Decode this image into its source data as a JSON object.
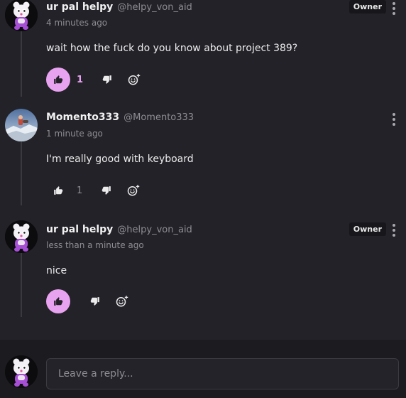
{
  "colors": {
    "background": "#232228",
    "reply_bar_background": "#1c1b20",
    "accent_pink": "#e8a3f0",
    "muted_text": "#8e8d94",
    "badge_background": "#17161b"
  },
  "comments": [
    {
      "author": "ur pal helpy",
      "handle": "@helpy_von_aid",
      "time": "4 minutes ago",
      "badge": "Owner",
      "text": "wait how the fuck do you know about project 389?",
      "likes": "1",
      "liked": true,
      "avatar_icon": "helpy-avatar-icon"
    },
    {
      "author": "Momento333",
      "handle": "@Momento333",
      "time": "1 minute ago",
      "badge": "",
      "text": "I'm really good with keyboard",
      "likes": "1",
      "liked": false,
      "avatar_icon": "momento-avatar-icon"
    },
    {
      "author": "ur pal helpy",
      "handle": "@helpy_von_aid",
      "time": "less than a minute ago",
      "badge": "Owner",
      "text": "nice",
      "likes": "",
      "liked": true,
      "avatar_icon": "helpy-avatar-icon"
    }
  ],
  "icons": {
    "like": "thumbs-up-icon",
    "dislike": "thumbs-down-icon",
    "react": "add-reaction-icon",
    "menu": "more-vertical-icon"
  },
  "reply": {
    "placeholder": "Leave a reply..."
  }
}
